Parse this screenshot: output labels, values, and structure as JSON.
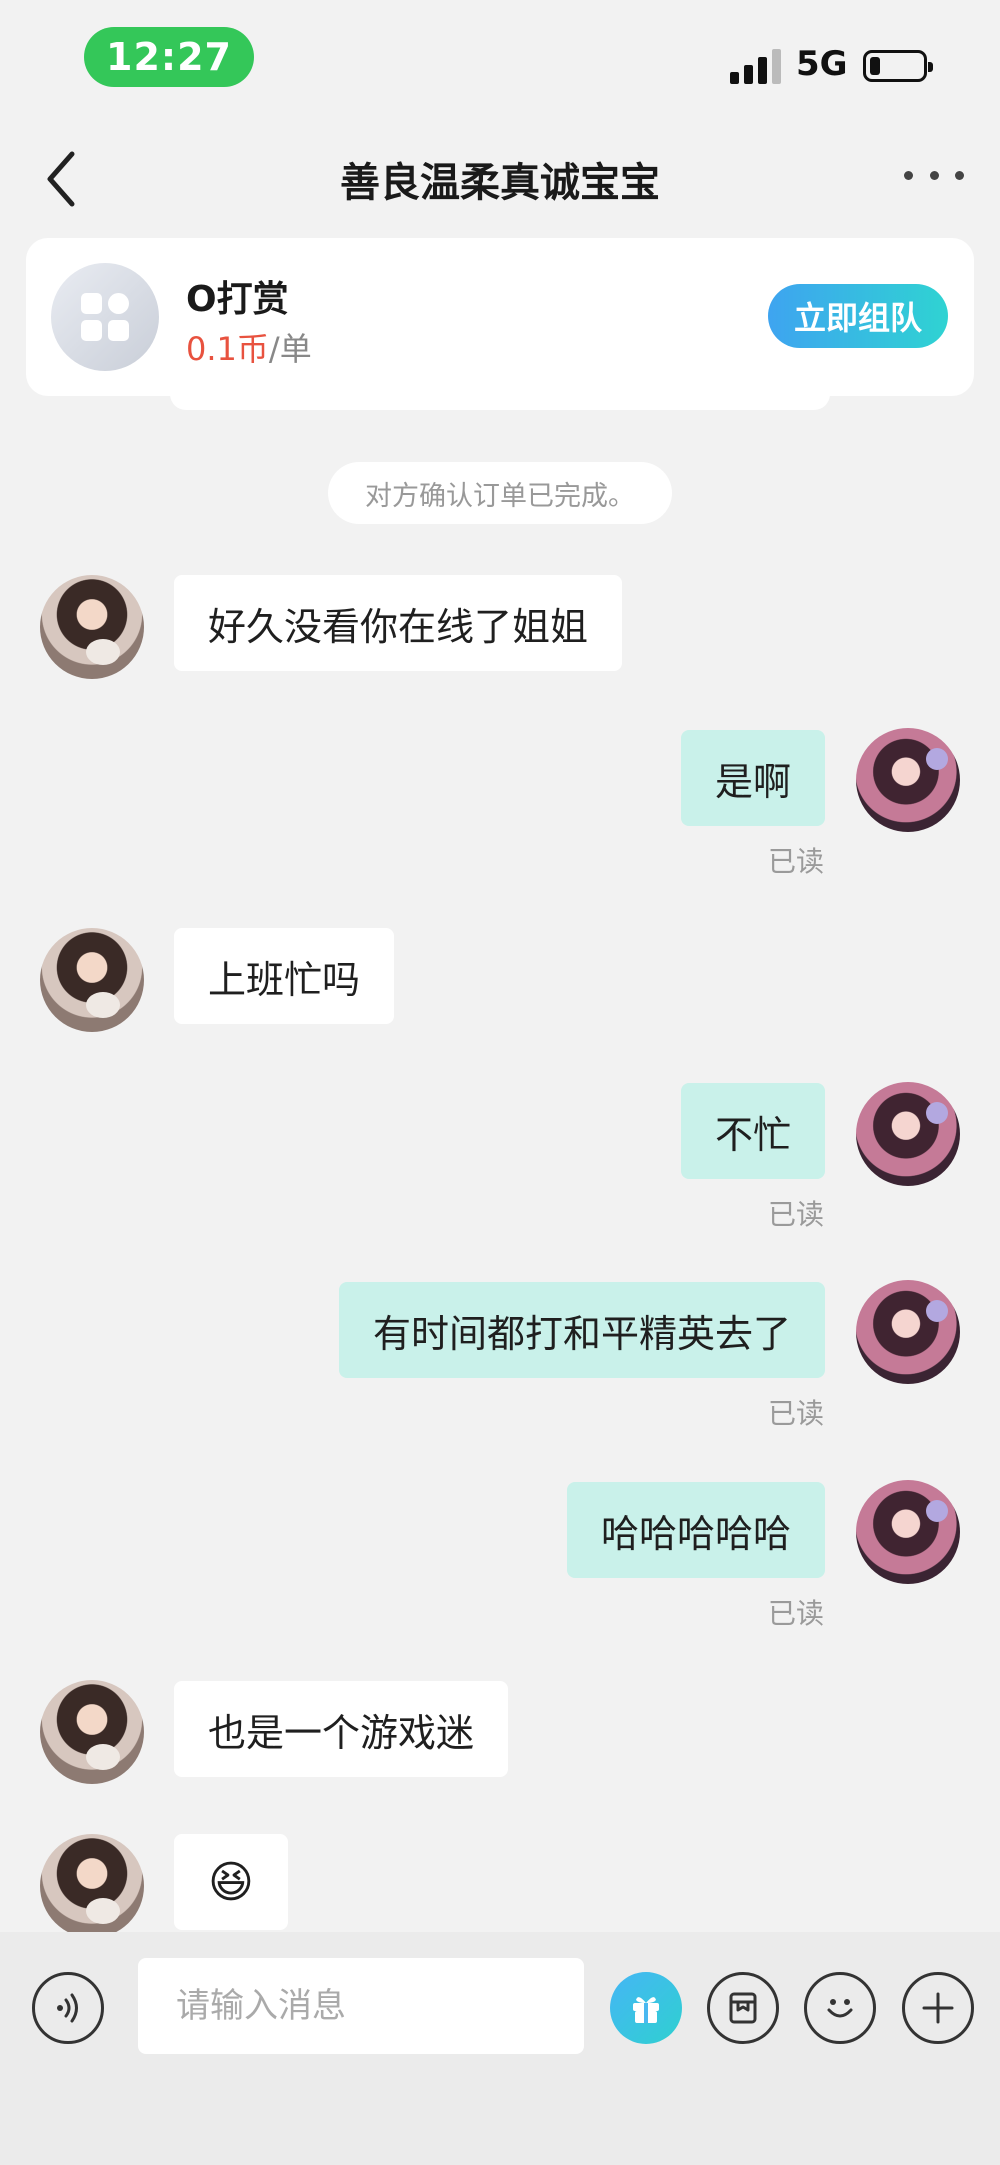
{
  "status_bar": {
    "time": "12:27",
    "network": "5G"
  },
  "header": {
    "title": "善良温柔真诚宝宝"
  },
  "order_card": {
    "title": "O打赏",
    "price_value": "0.1币",
    "price_unit": "/单",
    "team_button": "立即组队"
  },
  "system_notice": "对方确认订单已完成。",
  "messages": [
    {
      "side": "left",
      "text": "好久没看你在线了姐姐"
    },
    {
      "side": "right",
      "text": "是啊",
      "status": "已读"
    },
    {
      "side": "left",
      "text": "上班忙吗"
    },
    {
      "side": "right",
      "text": "不忙",
      "status": "已读"
    },
    {
      "side": "right",
      "text": "有时间都打和平精英去了",
      "status": "已读"
    },
    {
      "side": "right",
      "text": "哈哈哈哈哈",
      "status": "已读"
    },
    {
      "side": "left",
      "text": "也是一个游戏迷"
    },
    {
      "side": "left",
      "text": "😆"
    }
  ],
  "input_bar": {
    "placeholder": "请输入消息"
  },
  "colors": {
    "accent_green": "#34c759",
    "bubble_self": "#c9f1ea",
    "price_red": "#e8523f",
    "button_gradient_start": "#3ea4f0",
    "button_gradient_end": "#2fd3d2"
  },
  "icons": [
    "back-arrow-icon",
    "more-dots-icon",
    "voice-icon",
    "gift-icon",
    "card-icon",
    "emoji-icon",
    "plus-icon"
  ]
}
